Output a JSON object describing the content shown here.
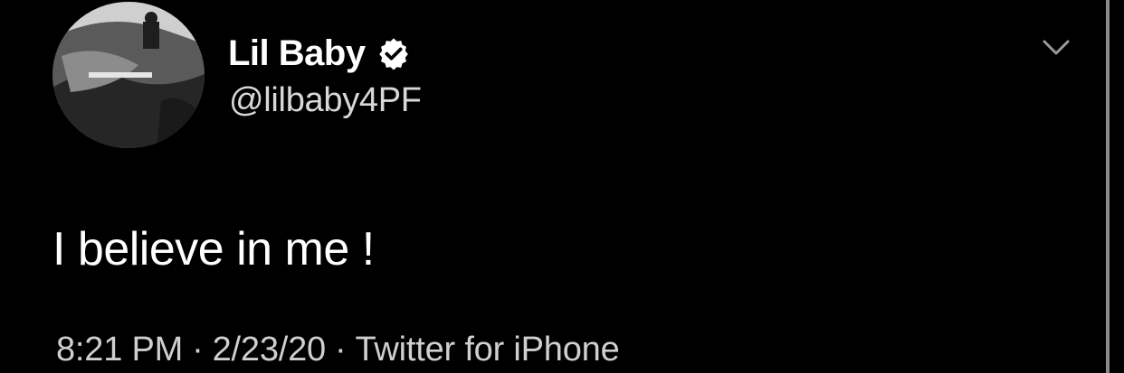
{
  "tweet": {
    "author": {
      "display_name": "Lil Baby",
      "handle": "@lilbaby4PF",
      "verified": true,
      "avatar_icon": "profile-photo"
    },
    "text": "I believe in me !",
    "meta": {
      "time": "8:21 PM",
      "separator": "·",
      "date": "2/23/20",
      "source": "Twitter for iPhone"
    },
    "menu_icon": "chevron-down-icon"
  },
  "colors": {
    "background": "#000000",
    "primary_text": "#ffffff",
    "secondary_text": "#cfcfcf"
  }
}
